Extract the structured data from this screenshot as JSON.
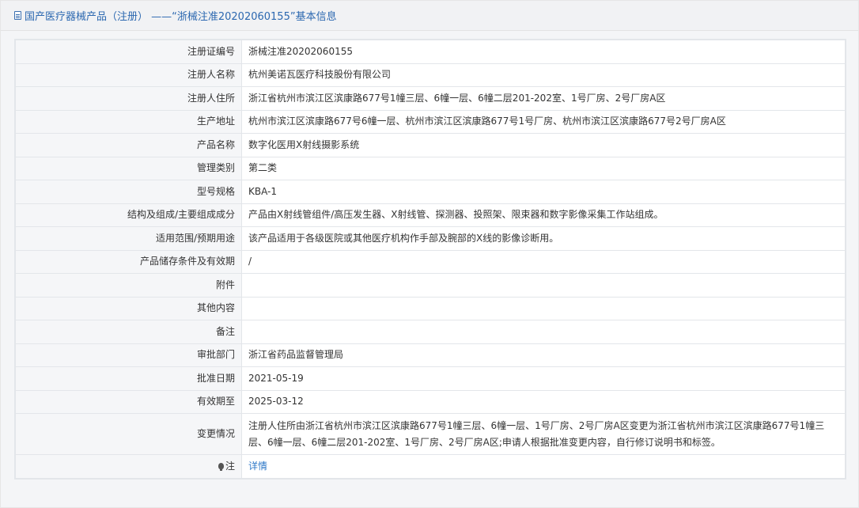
{
  "header": {
    "title": "国产医疗器械产品（注册） ——“浙械注准20202060155”基本信息",
    "icon": "document-icon"
  },
  "rows": [
    {
      "label": "注册证编号",
      "value": "浙械注准20202060155"
    },
    {
      "label": "注册人名称",
      "value": "杭州美诺瓦医疗科技股份有限公司"
    },
    {
      "label": "注册人住所",
      "value": "浙江省杭州市滨江区滨康路677号1幢三层、6幢一层、6幢二层201-202室、1号厂房、2号厂房A区"
    },
    {
      "label": "生产地址",
      "value": "杭州市滨江区滨康路677号6幢一层、杭州市滨江区滨康路677号1号厂房、杭州市滨江区滨康路677号2号厂房A区"
    },
    {
      "label": "产品名称",
      "value": "数字化医用X射线摄影系统"
    },
    {
      "label": "管理类别",
      "value": "第二类"
    },
    {
      "label": "型号规格",
      "value": "KBA-1"
    },
    {
      "label": "结构及组成/主要组成成分",
      "value": "产品由X射线管组件/高压发生器、X射线管、探测器、投照架、限束器和数字影像采集工作站组成。"
    },
    {
      "label": "适用范围/预期用途",
      "value": "该产品适用于各级医院或其他医疗机构作手部及腕部的X线的影像诊断用。"
    },
    {
      "label": "产品储存条件及有效期",
      "value": "/"
    },
    {
      "label": "附件",
      "value": ""
    },
    {
      "label": "其他内容",
      "value": ""
    },
    {
      "label": "备注",
      "value": ""
    },
    {
      "label": "审批部门",
      "value": "浙江省药品监督管理局"
    },
    {
      "label": "批准日期",
      "value": "2021-05-19"
    },
    {
      "label": "有效期至",
      "value": "2025-03-12"
    },
    {
      "label": "变更情况",
      "value": "注册人住所由浙江省杭州市滨江区滨康路677号1幢三层、6幢一层、1号厂房、2号厂房A区变更为浙江省杭州市滨江区滨康路677号1幢三层、6幢一层、6幢二层201-202室、1号厂房、2号厂房A区;申请人根据批准变更内容，自行修订说明书和标签。"
    }
  ],
  "note": {
    "label": "注",
    "icon": "lightbulb-icon",
    "link_text": "详情"
  },
  "colors": {
    "title": "#2c68b0",
    "link": "#2f79c8",
    "label_bg": "#f5f6f8",
    "border": "#e3e6ea"
  }
}
